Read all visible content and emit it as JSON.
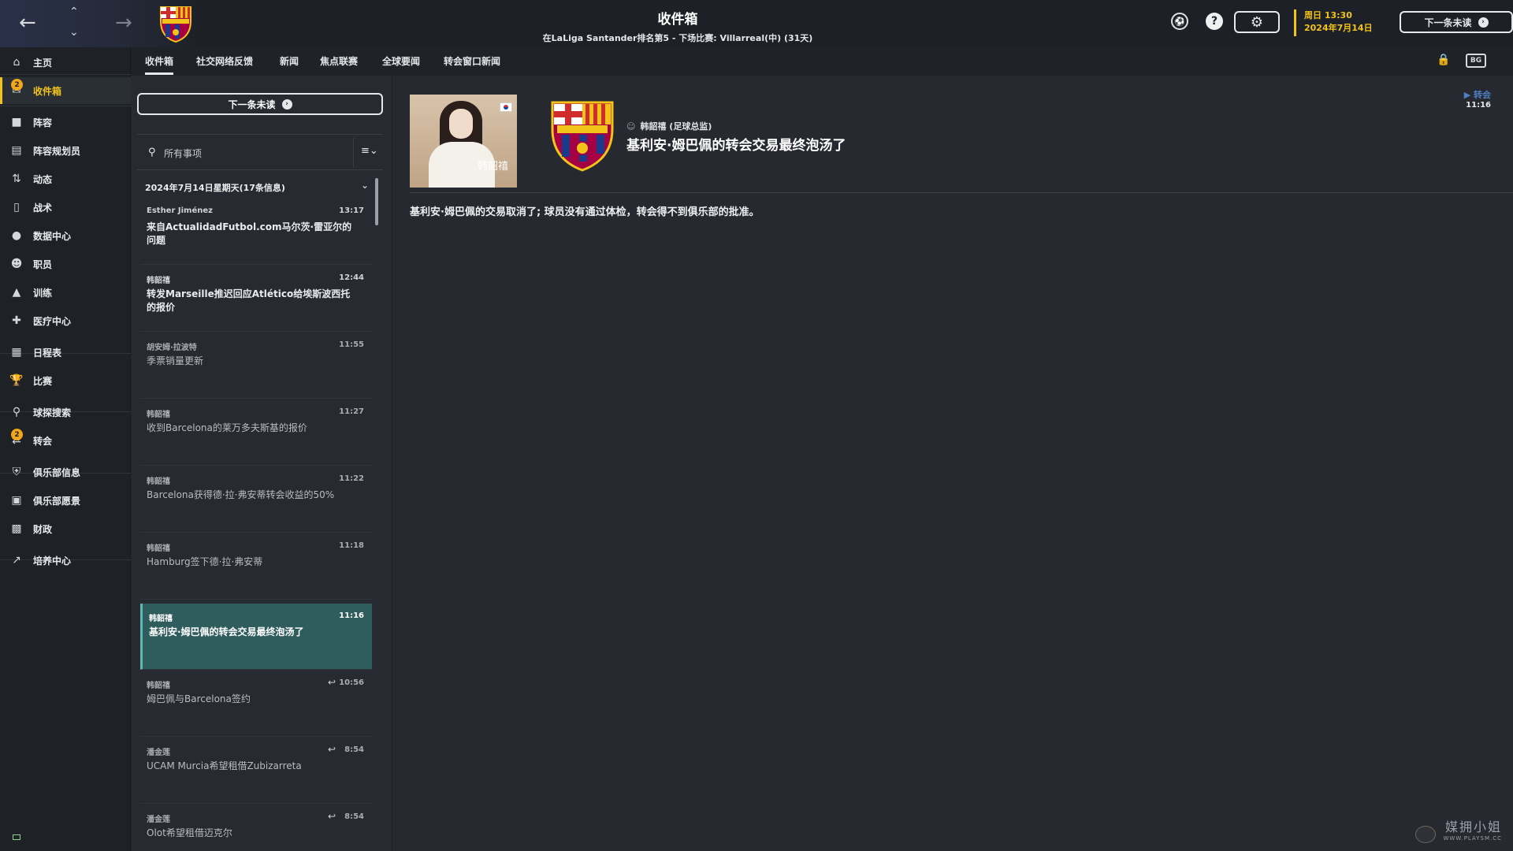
{
  "header": {
    "title": "收件箱",
    "subtitle": "在LaLiga Santander排名第5 - 下场比赛: Villarreal(中) (31天)",
    "date_line1": "周日 13:30",
    "date_line2": "2024年7月14日",
    "next_unread": "下一条未读"
  },
  "sidebar": {
    "items": [
      {
        "label": "主页",
        "icon": "home-icon"
      },
      {
        "label": "收件箱",
        "icon": "inbox-icon",
        "badge": "2"
      },
      {
        "label": "阵容",
        "icon": "shirt-icon"
      },
      {
        "label": "阵容规划员",
        "icon": "clipboard-icon"
      },
      {
        "label": "动态",
        "icon": "dynamics-icon"
      },
      {
        "label": "战术",
        "icon": "tactics-icon"
      },
      {
        "label": "数据中心",
        "icon": "data-icon"
      },
      {
        "label": "职员",
        "icon": "staff-icon"
      },
      {
        "label": "训练",
        "icon": "training-icon"
      },
      {
        "label": "医疗中心",
        "icon": "medical-icon"
      },
      {
        "label": "日程表",
        "icon": "calendar-icon"
      },
      {
        "label": "比赛",
        "icon": "trophy-icon"
      },
      {
        "label": "球探搜索",
        "icon": "scouting-icon"
      },
      {
        "label": "转会",
        "icon": "transfers-icon",
        "badge": "2"
      },
      {
        "label": "俱乐部信息",
        "icon": "club-info-icon"
      },
      {
        "label": "俱乐部愿景",
        "icon": "vision-icon"
      },
      {
        "label": "财政",
        "icon": "finance-icon"
      },
      {
        "label": "培养中心",
        "icon": "development-icon"
      }
    ]
  },
  "tabs": [
    "收件箱",
    "社交网络反馈",
    "新闻",
    "焦点联赛",
    "全球要闻",
    "转会窗口新闻"
  ],
  "inbox": {
    "next_unread": "下一条未读",
    "search_placeholder": "所有事项",
    "group_header": "2024年7月14日星期天(17条信息)",
    "messages": [
      {
        "from": "Esther Jiménez",
        "time": "13:17",
        "subject": "来自ActualidadFutbol.com马尔茨·雷亚尔的问题"
      },
      {
        "from": "韩韶禧",
        "time": "12:44",
        "subject": "转发Marseille推迟回应Atlético给埃斯波西托的报价"
      },
      {
        "from": "胡安姆·拉波特",
        "time": "11:55",
        "subject": "季票销量更新"
      },
      {
        "from": "韩韶禧",
        "time": "11:27",
        "subject": "收到Barcelona的莱万多夫斯基的报价"
      },
      {
        "from": "韩韶禧",
        "time": "11:22",
        "subject": "Barcelona获得德·拉·弗安蒂转会收益的50%"
      },
      {
        "from": "韩韶禧",
        "time": "11:18",
        "subject": "Hamburg签下德·拉·弗安蒂"
      },
      {
        "from": "韩韶禧",
        "time": "11:16",
        "subject": "基利安·姆巴佩的转会交易最终泡汤了"
      },
      {
        "from": "韩韶禧",
        "time": "10:56",
        "subject": "姆巴佩与Barcelona签约"
      },
      {
        "from": "潘金莲",
        "time": "8:54",
        "subject": "UCAM Murcia希望租借Zubizarreta"
      },
      {
        "from": "潘金莲",
        "time": "8:54",
        "subject": "Olot希望租借迈克尔"
      }
    ]
  },
  "message_view": {
    "photo_name": "韩韶禧",
    "sender": "韩韶禧 (足球总监)",
    "headline": "基利安·姆巴佩的转会交易最终泡汤了",
    "tag": "转会",
    "time": "11:16",
    "body": "基利安·姆巴佩的交易取消了; 球员没有通过体检，转会得不到俱乐部的批准。"
  },
  "watermark": {
    "text": "媒拥小姐",
    "url": "WWW.PLAYSM.CC"
  },
  "colors": {
    "accent": "#f2c319",
    "selected_row": "#2f5c5c",
    "tag": "#4f7fc2"
  }
}
